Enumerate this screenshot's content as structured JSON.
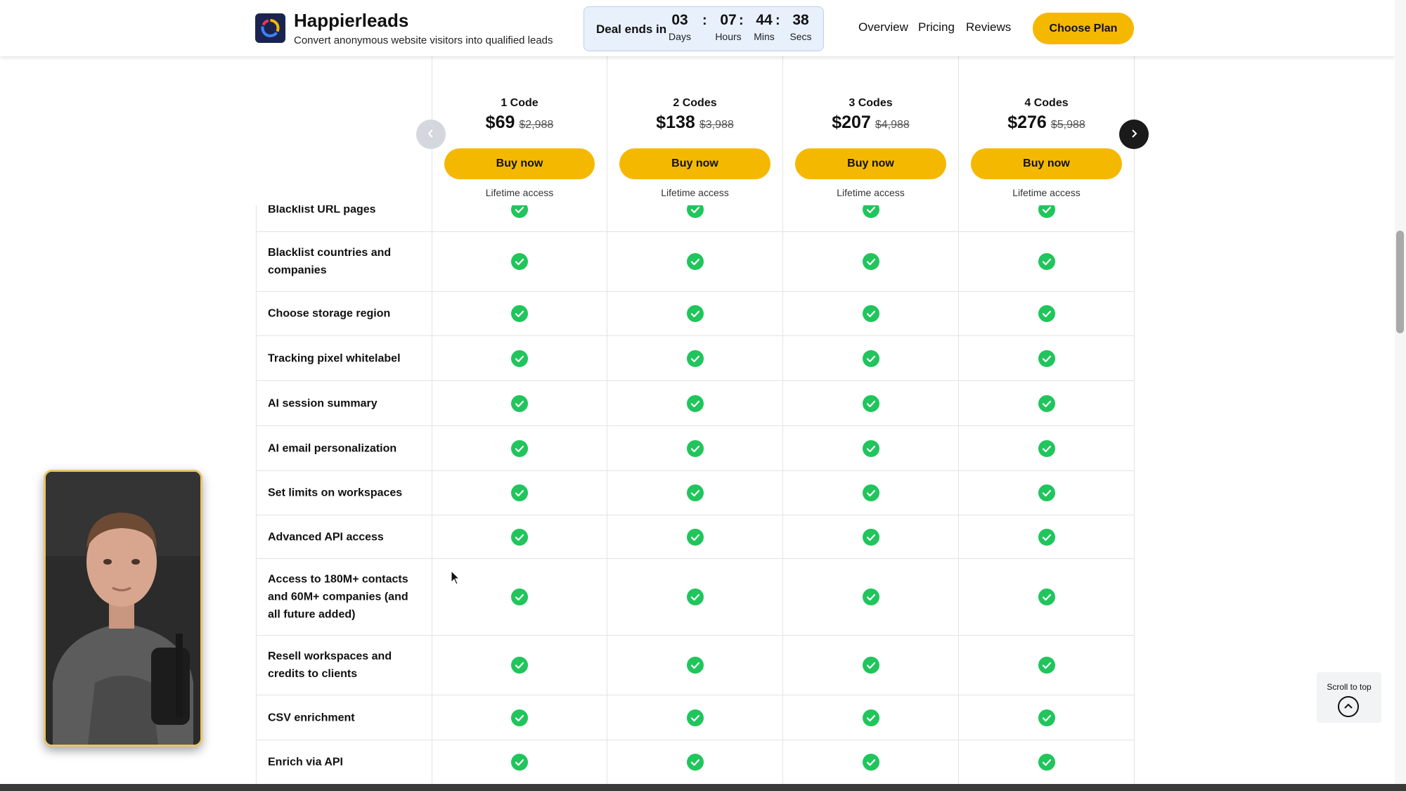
{
  "header": {
    "brand_name": "Happierleads",
    "tagline": "Convert anonymous website visitors into qualified leads",
    "countdown": {
      "label": "Deal ends in",
      "units": [
        {
          "value": "03",
          "label": "Days"
        },
        {
          "value": "07",
          "label": "Hours"
        },
        {
          "value": "44",
          "label": "Mins"
        },
        {
          "value": "38",
          "label": "Secs"
        }
      ]
    },
    "nav": [
      "Overview",
      "Pricing",
      "Reviews"
    ],
    "cta": "Choose Plan"
  },
  "plans": [
    {
      "name": "1 Code",
      "price": "$69",
      "old_price": "$2,988",
      "button": "Buy now",
      "note": "Lifetime access"
    },
    {
      "name": "2 Codes",
      "price": "$138",
      "old_price": "$3,988",
      "button": "Buy now",
      "note": "Lifetime access"
    },
    {
      "name": "3 Codes",
      "price": "$207",
      "old_price": "$4,988",
      "button": "Buy now",
      "note": "Lifetime access"
    },
    {
      "name": "4 Codes",
      "price": "$276",
      "old_price": "$5,988",
      "button": "Buy now",
      "note": "Lifetime access"
    }
  ],
  "features": [
    "Blacklist URL pages",
    "Blacklist countries and companies",
    "Choose storage region",
    "Tracking pixel whitelabel",
    "AI session summary",
    "AI email personalization",
    "Set limits on workspaces",
    "Advanced API access",
    "Access to 180M+ contacts and 60M+ companies (and all future added)",
    "Resell workspaces and credits to clients",
    "CSV enrichment",
    "Enrich via API"
  ],
  "icons": {
    "check": "check-circle-icon",
    "prev": "chevron-left-icon",
    "next": "chevron-right-icon",
    "scroll_top": "chevron-up-icon",
    "logo": "happierleads-logo-icon"
  },
  "scroll_top_label": "Scroll to top",
  "colors": {
    "accent": "#f5b800",
    "check": "#20c55c",
    "countdown_bg": "#e8f0fc",
    "dark": "#1a1a1a"
  }
}
